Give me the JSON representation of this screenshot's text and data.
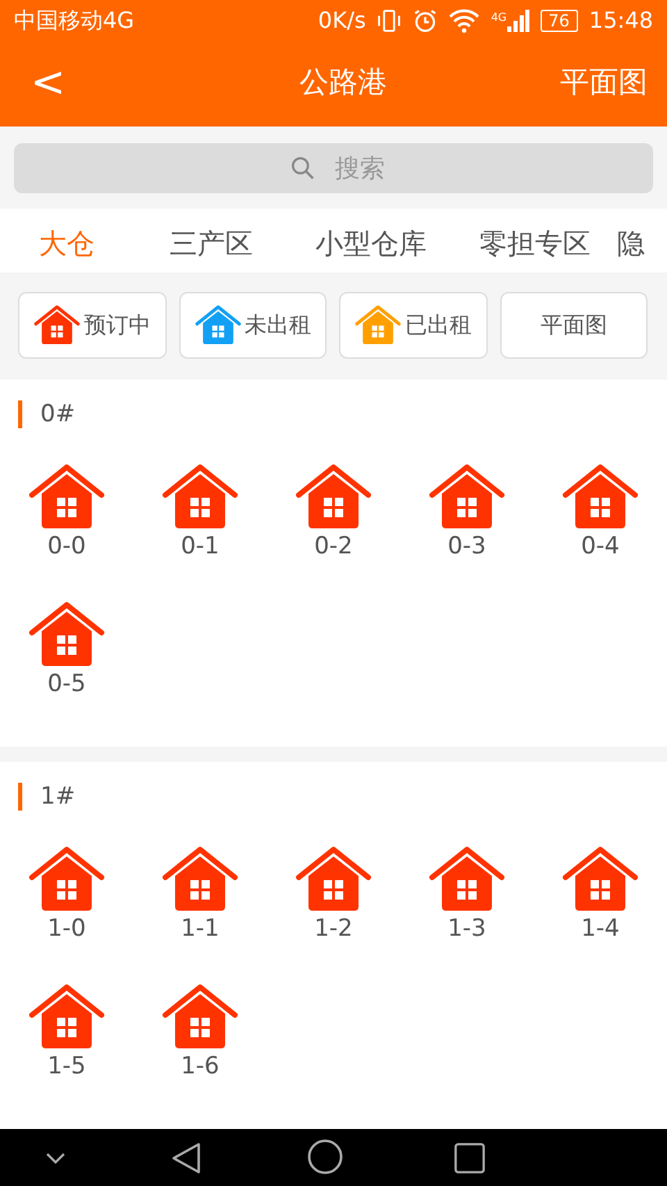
{
  "status_bar": {
    "carrier": "中国移动4G",
    "speed": "0K/s",
    "network": "4G",
    "battery": "76",
    "time": "15:48"
  },
  "app_bar": {
    "back": "<",
    "title": "公路港",
    "action": "平面图"
  },
  "search": {
    "placeholder": "搜索"
  },
  "tabs": [
    {
      "label": "大仓",
      "selected": true
    },
    {
      "label": "三产区",
      "selected": false
    },
    {
      "label": "小型仓库",
      "selected": false
    },
    {
      "label": "零担专区",
      "selected": false
    },
    {
      "label": "隐",
      "selected": false
    }
  ],
  "legend": [
    {
      "kind": "status",
      "label": "预订中",
      "color": "#ff3300"
    },
    {
      "kind": "status",
      "label": "未出租",
      "color": "#12a0f5"
    },
    {
      "kind": "status",
      "label": "已出租",
      "color": "#ffa000"
    },
    {
      "kind": "plain",
      "label": "平面图"
    }
  ],
  "sections": [
    {
      "title": "0#",
      "units": [
        {
          "label": "0-0",
          "color": "#ff3300"
        },
        {
          "label": "0-1",
          "color": "#ff3300"
        },
        {
          "label": "0-2",
          "color": "#ff3300"
        },
        {
          "label": "0-3",
          "color": "#ff3300"
        },
        {
          "label": "0-4",
          "color": "#ff3300"
        },
        {
          "label": "0-5",
          "color": "#ff3300"
        }
      ]
    },
    {
      "title": "1#",
      "units": [
        {
          "label": "1-0",
          "color": "#ff3300"
        },
        {
          "label": "1-1",
          "color": "#ff3300"
        },
        {
          "label": "1-2",
          "color": "#ff3300"
        },
        {
          "label": "1-3",
          "color": "#ff3300"
        },
        {
          "label": "1-4",
          "color": "#ff3300"
        },
        {
          "label": "1-5",
          "color": "#ff3300"
        },
        {
          "label": "1-6",
          "color": "#ff3300"
        }
      ]
    }
  ]
}
